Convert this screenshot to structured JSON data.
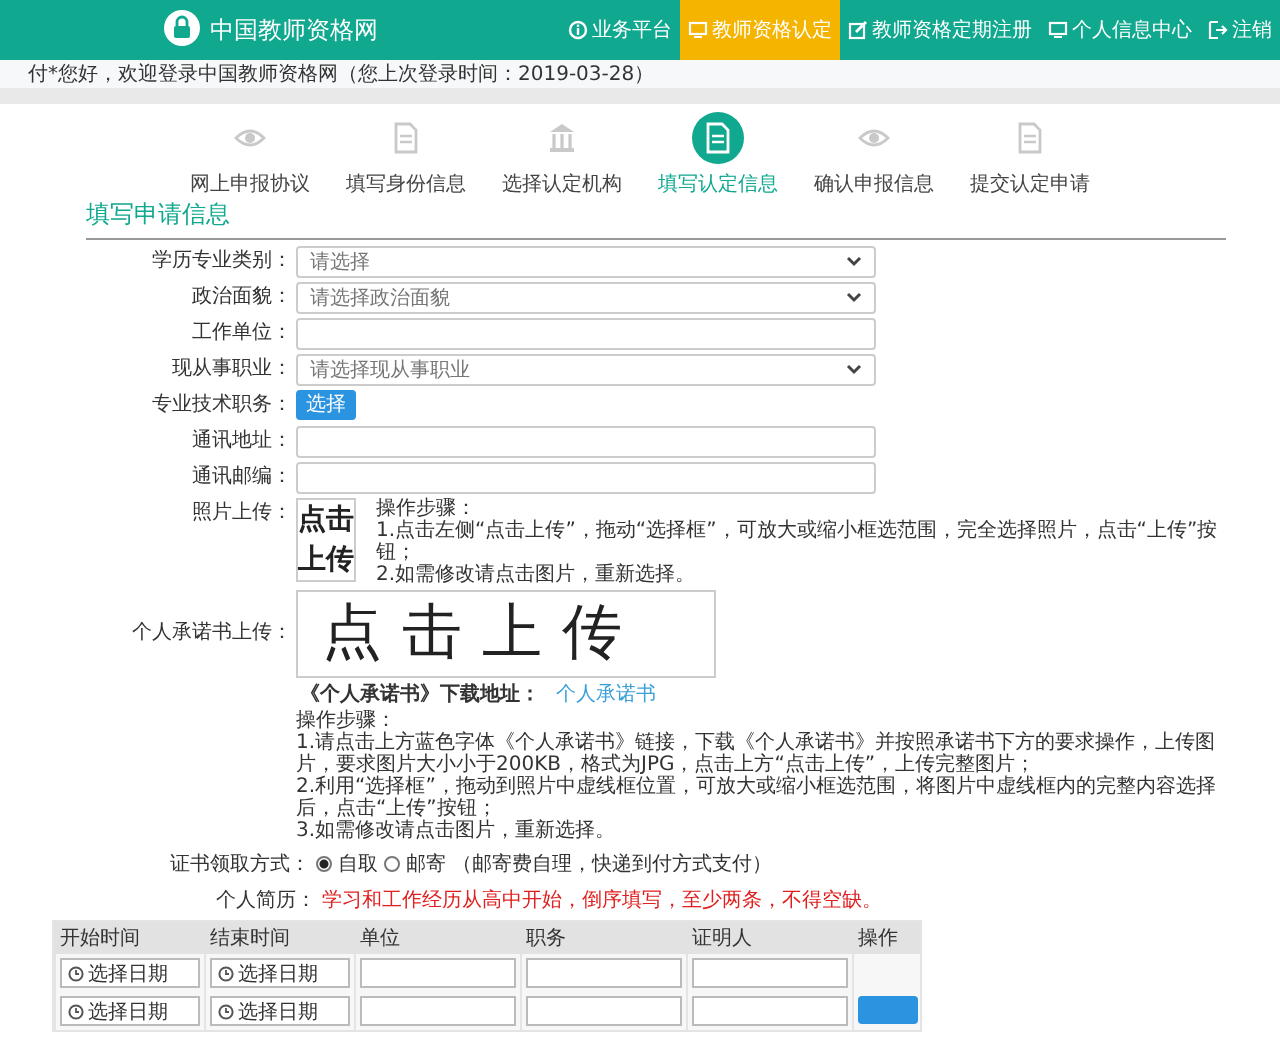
{
  "header": {
    "site_name": "中国教师资格网",
    "nav": [
      {
        "label": "业务平台",
        "kind": "info",
        "selected": false
      },
      {
        "label": "教师资格认定",
        "kind": "monitor",
        "selected": true
      },
      {
        "label": "教师资格定期注册",
        "kind": "edit",
        "selected": false
      },
      {
        "label": "个人信息中心",
        "kind": "monitor",
        "selected": false
      },
      {
        "label": "注销",
        "kind": "logout",
        "selected": false
      }
    ]
  },
  "welcome": "付*您好，欢迎登录中国教师资格网（您上次登录时间：2019-03-28）",
  "steps": [
    {
      "label": "网上申报协议",
      "kind": "eye",
      "selected": false
    },
    {
      "label": "填写身份信息",
      "kind": "document",
      "selected": false
    },
    {
      "label": "选择认定机构",
      "kind": "building",
      "selected": false
    },
    {
      "label": "填写认定信息",
      "kind": "document",
      "selected": true
    },
    {
      "label": "确认申报信息",
      "kind": "eye",
      "selected": false
    },
    {
      "label": "提交认定申请",
      "kind": "document",
      "selected": false
    }
  ],
  "section_title": "填写申请信息",
  "fields": [
    {
      "label": "学历专业类别：",
      "kind": "select",
      "placeholder": "请选择"
    },
    {
      "label": "政治面貌：",
      "kind": "select",
      "placeholder": "请选择政治面貌"
    },
    {
      "label": "工作单位：",
      "kind": "text"
    },
    {
      "label": "现从事职业：",
      "kind": "select",
      "placeholder": "请选择现从事职业"
    },
    {
      "label": "专业技术职务：",
      "kind": "button",
      "button": "选择"
    },
    {
      "label": "通讯地址：",
      "kind": "text"
    },
    {
      "label": "通讯邮编：",
      "kind": "text"
    }
  ],
  "photo_upload": {
    "label": "照片上传：",
    "upload_text": "点击上传",
    "instructions_title": "操作步骤：",
    "instructions": [
      "1.点击左侧“点击上传”，拖动“选择框”，可放大或缩小框选范围，完全选择照片，点击“上传”按钮；",
      "2.如需修改请点击图片，重新选择。"
    ]
  },
  "commitment_upload": {
    "label": "个人承诺书上传：",
    "upload_text": "点击上传",
    "download_label": "《个人承诺书》下载地址：",
    "download_link": "个人承诺书",
    "instructions_title": "操作步骤：",
    "instructions": [
      "1.请点击上方蓝色字体《个人承诺书》链接，下载《个人承诺书》并按照承诺书下方的要求操作，上传图片，要求图片大小小于200KB，格式为JPG，点击上方“点击上传”，上传完整图片；",
      "2.利用“选择框”，拖动到照片中虚线框位置，可放大或缩小框选范围，将图片中虚线框内的完整内容选择后，点击“上传”按钮；",
      "3.如需修改请点击图片，重新选择。"
    ]
  },
  "delivery": {
    "label": "证书领取方式：",
    "options": [
      {
        "label": "自取",
        "selected": true
      },
      {
        "label": "邮寄",
        "selected": false
      }
    ],
    "note": "（邮寄费自理，快递到付方式支付）"
  },
  "resume": {
    "label": "个人简历：",
    "note": "学习和工作经历从高中开始，倒序填写，至少两条，不得空缺。",
    "columns": [
      "开始时间",
      "结束时间",
      "单位",
      "职务",
      "证明人",
      "操作"
    ],
    "rows": [
      {
        "cells": [
          {
            "kind": "date",
            "placeholder": "选择日期"
          },
          {
            "kind": "date",
            "placeholder": "选择日期"
          },
          {
            "kind": "text"
          },
          {
            "kind": "text"
          },
          {
            "kind": "text"
          }
        ],
        "has_action": false
      },
      {
        "cells": [
          {
            "kind": "date",
            "placeholder": "选择日期"
          },
          {
            "kind": "date",
            "placeholder": "选择日期"
          },
          {
            "kind": "text"
          },
          {
            "kind": "text"
          },
          {
            "kind": "text"
          }
        ],
        "has_action": true
      }
    ]
  }
}
